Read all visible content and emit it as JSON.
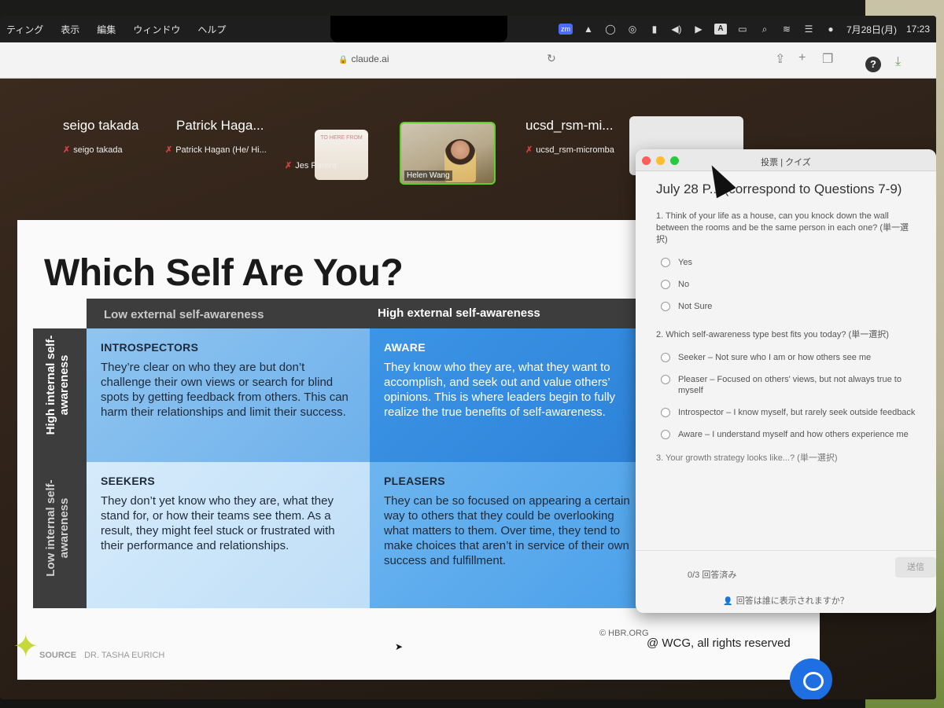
{
  "menubar": {
    "items": [
      "ティング",
      "表示",
      "編集",
      "ウィンドウ",
      "ヘルプ"
    ],
    "status": {
      "zoom_icon": "zm",
      "input_icon": "A",
      "date": "7月28日(月)",
      "time": "17:23"
    }
  },
  "browser": {
    "url": "claude.ai"
  },
  "zoom": {
    "participants": [
      {
        "name": "seigo takada",
        "sub": "seigo takada"
      },
      {
        "name": "Patrick Haga...",
        "sub": "Patrick Hagan (He/ Hi..."
      },
      {
        "name": "",
        "sub": "Jes Parent"
      },
      {
        "name": "",
        "sub": "Helen Wang"
      },
      {
        "name": "ucsd_rsm-mi...",
        "sub": "ucsd_rsm-micromba"
      }
    ],
    "jes_thumb_text": "TO HERE FROM"
  },
  "slide": {
    "title": "Which Self Are You?",
    "col_low": "Low external self-awareness",
    "col_high": "High external self-awareness",
    "row_high": "High internal self-awareness",
    "row_low": "Low internal self-awareness",
    "cells": {
      "introspectors": {
        "heading": "INTROSPECTORS",
        "text": "They’re clear on who they are but don’t challenge their own views or search for blind spots by getting feedback from others. This can harm their relationships and limit their success."
      },
      "aware": {
        "heading": "AWARE",
        "text": "They know who they are, what they want to accomplish, and seek out and value others’ opinions. This is where leaders begin to fully realize the true benefits of self-awareness."
      },
      "seekers": {
        "heading": "SEEKERS",
        "text": "They don’t yet know who they are, what they stand for, or how their teams see them. As a result, they might feel stuck or frustrated with their performance and relationships."
      },
      "pleasers": {
        "heading": "PLEASERS",
        "text": "They can be so focused on appearing a certain way to others that they could be overlooking what matters to them. Over time, they tend to make choices that aren’t in service of their own success and fulfillment."
      }
    },
    "credit": "© HBR.ORG",
    "source_label": "SOURCE",
    "source_name": "DR. TASHA EURICH",
    "rights": "@ WCG, all rights reserved"
  },
  "quiz": {
    "window_title": "投票 | クイズ",
    "heading": "July 28 P... (correspond to Questions 7-9)",
    "q1": "1. Think of your life as a house, can you knock down the wall between the rooms and be the same person in each one? (単一選択)",
    "q1_options": [
      "Yes",
      "No",
      "Not Sure"
    ],
    "q2": "2. Which self-awareness type best fits you today? (単一選択)",
    "q2_options": [
      "Seeker – Not sure who I am or how others see me",
      "Pleaser – Focused on others' views, but not always true to myself",
      "Introspector – I know myself, but rarely seek outside feedback",
      "Aware – I understand myself and how others experience me"
    ],
    "q3": "3. Your growth strategy looks like...? (単一選択)",
    "answered": "0/3 回答済み",
    "send": "送信",
    "visibility": "回答は誰に表示されますか？"
  }
}
